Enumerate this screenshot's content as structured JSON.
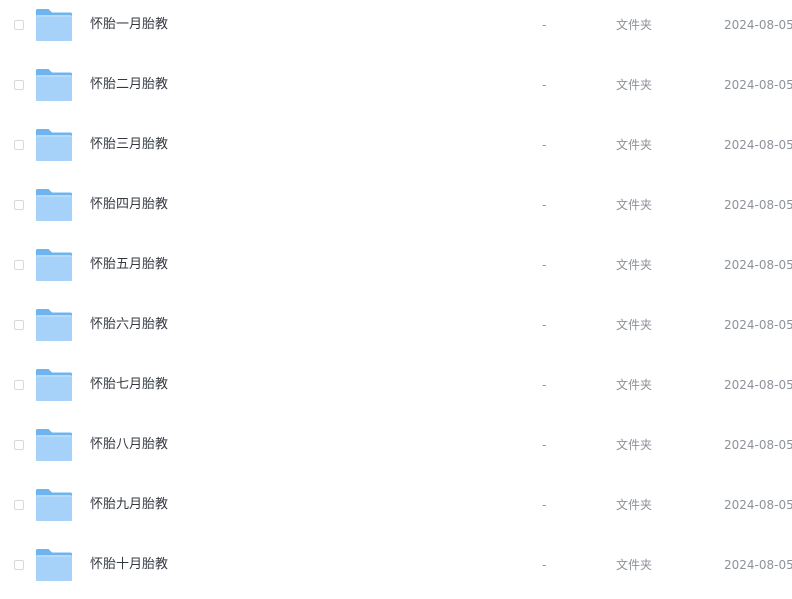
{
  "colors": {
    "folder_tab": "#6fb4ee",
    "folder_body": "#a6d2f9",
    "name_text": "#353a42",
    "meta_text": "#8d929a",
    "checkbox_border": "#d6d9de"
  },
  "icon": "folder-icon",
  "files": [
    {
      "name": "怀胎一月胎教",
      "size": "-",
      "type": "文件夹",
      "date": "2024-08-05"
    },
    {
      "name": "怀胎二月胎教",
      "size": "-",
      "type": "文件夹",
      "date": "2024-08-05"
    },
    {
      "name": "怀胎三月胎教",
      "size": "-",
      "type": "文件夹",
      "date": "2024-08-05"
    },
    {
      "name": "怀胎四月胎教",
      "size": "-",
      "type": "文件夹",
      "date": "2024-08-05"
    },
    {
      "name": "怀胎五月胎教",
      "size": "-",
      "type": "文件夹",
      "date": "2024-08-05"
    },
    {
      "name": "怀胎六月胎教",
      "size": "-",
      "type": "文件夹",
      "date": "2024-08-05"
    },
    {
      "name": "怀胎七月胎教",
      "size": "-",
      "type": "文件夹",
      "date": "2024-08-05"
    },
    {
      "name": "怀胎八月胎教",
      "size": "-",
      "type": "文件夹",
      "date": "2024-08-05"
    },
    {
      "name": "怀胎九月胎教",
      "size": "-",
      "type": "文件夹",
      "date": "2024-08-05"
    },
    {
      "name": "怀胎十月胎教",
      "size": "-",
      "type": "文件夹",
      "date": "2024-08-05"
    }
  ]
}
